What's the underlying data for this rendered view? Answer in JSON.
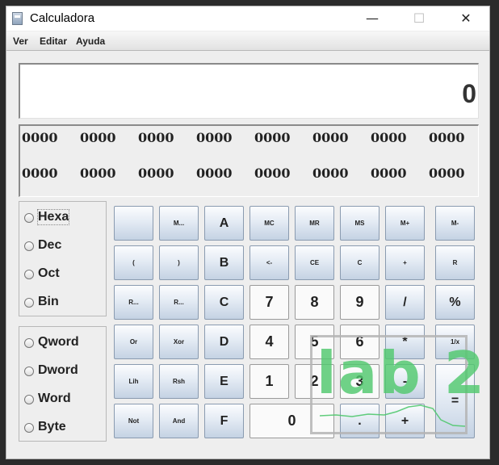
{
  "window": {
    "title": "Calculadora",
    "buttons": {
      "minimize": "—",
      "maximize": "☐",
      "close": "✕"
    }
  },
  "menu": [
    "Ver",
    "Editar",
    "Ayuda"
  ],
  "display": {
    "value": "0"
  },
  "bits": [
    [
      "0000",
      "0000",
      "0000",
      "0000",
      "0000",
      "0000",
      "0000",
      "0000"
    ],
    [
      "0000",
      "0000",
      "0000",
      "0000",
      "0000",
      "0000",
      "0000",
      "0000"
    ]
  ],
  "base_options": [
    "Hexa",
    "Dec",
    "Oct",
    "Bin"
  ],
  "word_options": [
    "Qword",
    "Dword",
    "Word",
    "Byte"
  ],
  "keys": {
    "row1": [
      "",
      "M...",
      "A",
      "MC",
      "MR",
      "MS",
      "M+",
      "M-"
    ],
    "row2": [
      "(",
      ")",
      "B",
      "<-",
      "CE",
      "C",
      "+",
      "R"
    ],
    "row3": [
      "R...",
      "R...",
      "C",
      "7",
      "8",
      "9",
      "/",
      "%"
    ],
    "row4": [
      "Or",
      "Xor",
      "D",
      "4",
      "5",
      "6",
      "*",
      "1/x"
    ],
    "row5": [
      "Lih",
      "Rsh",
      "E",
      "1",
      "2",
      "3",
      "-",
      "="
    ],
    "row6": [
      "Not",
      "And",
      "F",
      "0",
      ".",
      "+"
    ]
  },
  "watermark": {
    "text": "lab 2",
    "color": "#50c86e"
  }
}
